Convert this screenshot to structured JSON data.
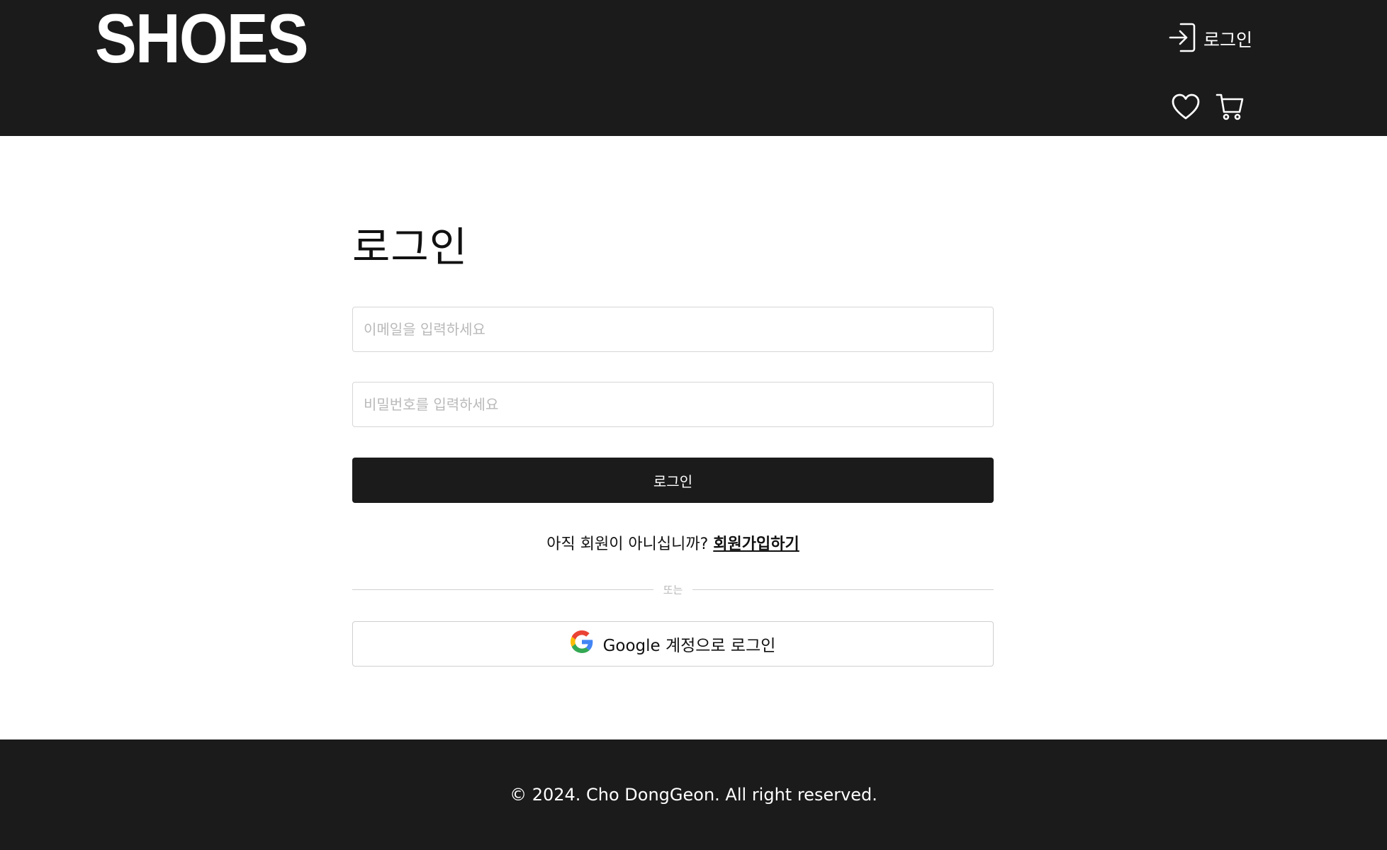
{
  "header": {
    "logo": "SHOES",
    "login_label": "로그인",
    "icons": {
      "login": "login-arrow-icon",
      "wishlist": "heart-icon",
      "cart": "cart-icon"
    }
  },
  "main": {
    "title": "로그인",
    "email": {
      "placeholder": "이메일을 입력하세요",
      "value": ""
    },
    "password": {
      "placeholder": "비밀번호를 입력하세요",
      "value": ""
    },
    "submit_label": "로그인",
    "signup_prompt": "아직 회원이 아니십니까?",
    "signup_link": "회원가입하기",
    "divider_text": "또는",
    "google_label": "Google 계정으로 로그인"
  },
  "footer": {
    "copyright": "© 2024. Cho DongGeon. All right reserved."
  },
  "colors": {
    "header_bg": "#1b1b1b",
    "footer_bg": "#1b1b1b",
    "button_bg": "#1b1b1b",
    "border": "#d6d6d6",
    "placeholder": "#b9b9b9"
  }
}
